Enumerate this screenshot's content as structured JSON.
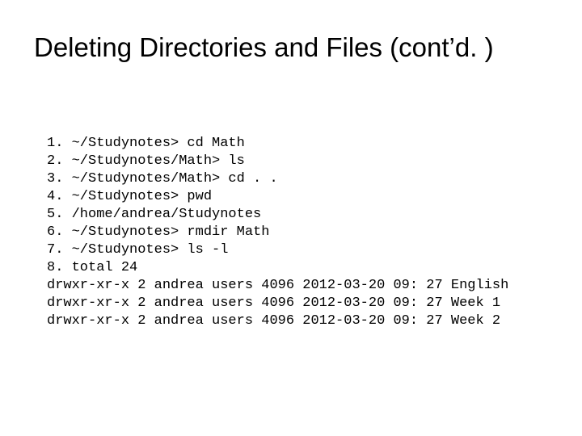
{
  "title": "Deleting Directories and Files (cont’d. )",
  "lines": {
    "l0": "1. ~/Studynotes> cd Math",
    "l1": "2. ~/Studynotes/Math> ls",
    "l2": "3. ~/Studynotes/Math> cd . .",
    "l3": "4. ~/Studynotes> pwd",
    "l4": "5. /home/andrea/Studynotes",
    "l5": "6. ~/Studynotes> rmdir Math",
    "l6": "7. ~/Studynotes> ls -l",
    "l7": "8. total 24",
    "l8": "drwxr-xr-x 2 andrea users 4096 2012-03-20 09: 27 English",
    "l9": "drwxr-xr-x 2 andrea users 4096 2012-03-20 09: 27 Week 1",
    "l10": "drwxr-xr-x 2 andrea users 4096 2012-03-20 09: 27 Week 2"
  }
}
